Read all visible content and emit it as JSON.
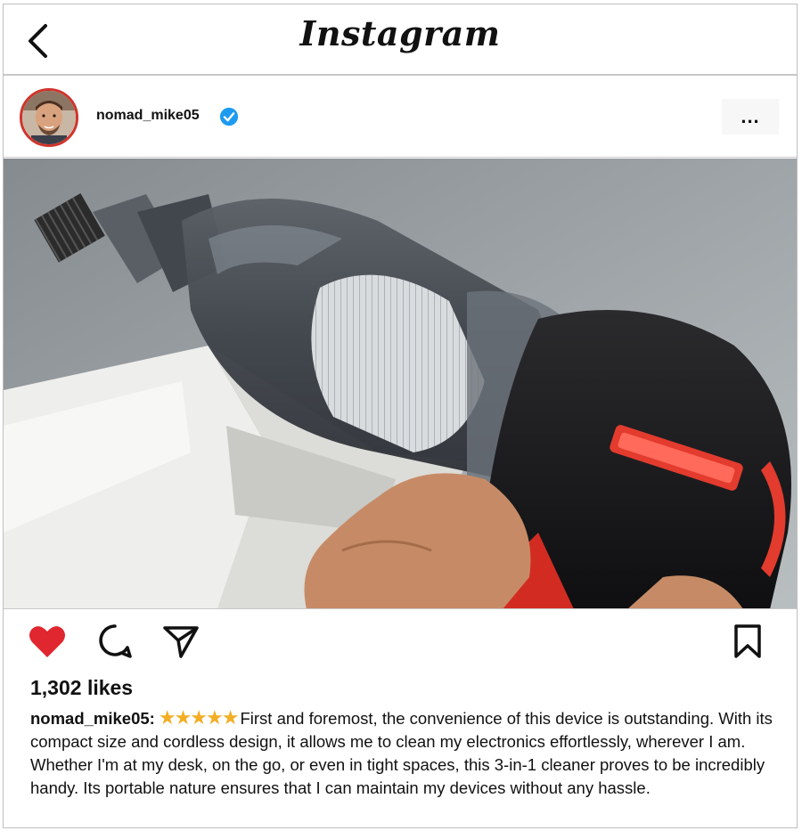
{
  "app": {
    "title": "Instagram"
  },
  "post": {
    "username": "nomad_mike05",
    "verified": true,
    "more_label": "...",
    "likes_text": "1,302 likes",
    "caption_user": "nomad_mike05:",
    "rating_stars": "★★★★★",
    "rating_value": 5,
    "caption_text": "First and foremost, the convenience of this device is outstanding. With its compact size and cordless design, it allows me to clean my electronics effortlessly, wherever I am. Whether I'm at my desk, on the go, or even in tight spaces, this 3-in-1 cleaner proves to be incredibly handy. Its portable nature ensures that I can maintain my devices without any hassle.",
    "liked": true
  },
  "icons": {
    "back": "chevron-left-icon",
    "verified": "verified-badge-icon",
    "like": "heart-icon",
    "comment": "comment-icon",
    "share": "send-icon",
    "save": "bookmark-icon"
  },
  "colors": {
    "heart": "#e0262f",
    "verified": "#1d9bf0",
    "stars": "#f2ae24",
    "avatar_ring": "#d0342c"
  }
}
